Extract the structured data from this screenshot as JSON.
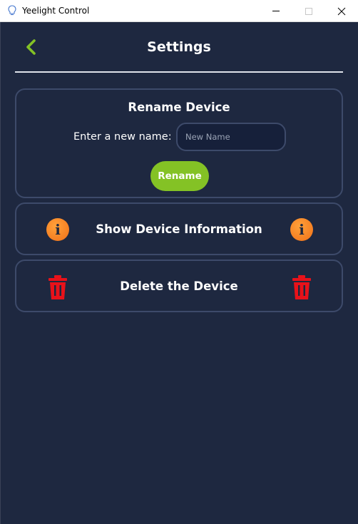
{
  "window": {
    "title": "Yeelight Control",
    "icon": "lightbulb-icon"
  },
  "header": {
    "title": "Settings",
    "back_icon": "chevron-left-icon"
  },
  "rename": {
    "title": "Rename Device",
    "label": "Enter a new name:",
    "input_placeholder": "New Name",
    "input_value": "",
    "button_label": "Rename"
  },
  "info": {
    "label": "Show Device Information",
    "icon": "info-icon"
  },
  "delete": {
    "label": "Delete the Device",
    "icon": "trash-icon"
  },
  "colors": {
    "background": "#1e2840",
    "card_border": "#3d4a6a",
    "accent_green": "#84c225",
    "info_orange": "#f07018",
    "delete_red": "#e8121a"
  }
}
